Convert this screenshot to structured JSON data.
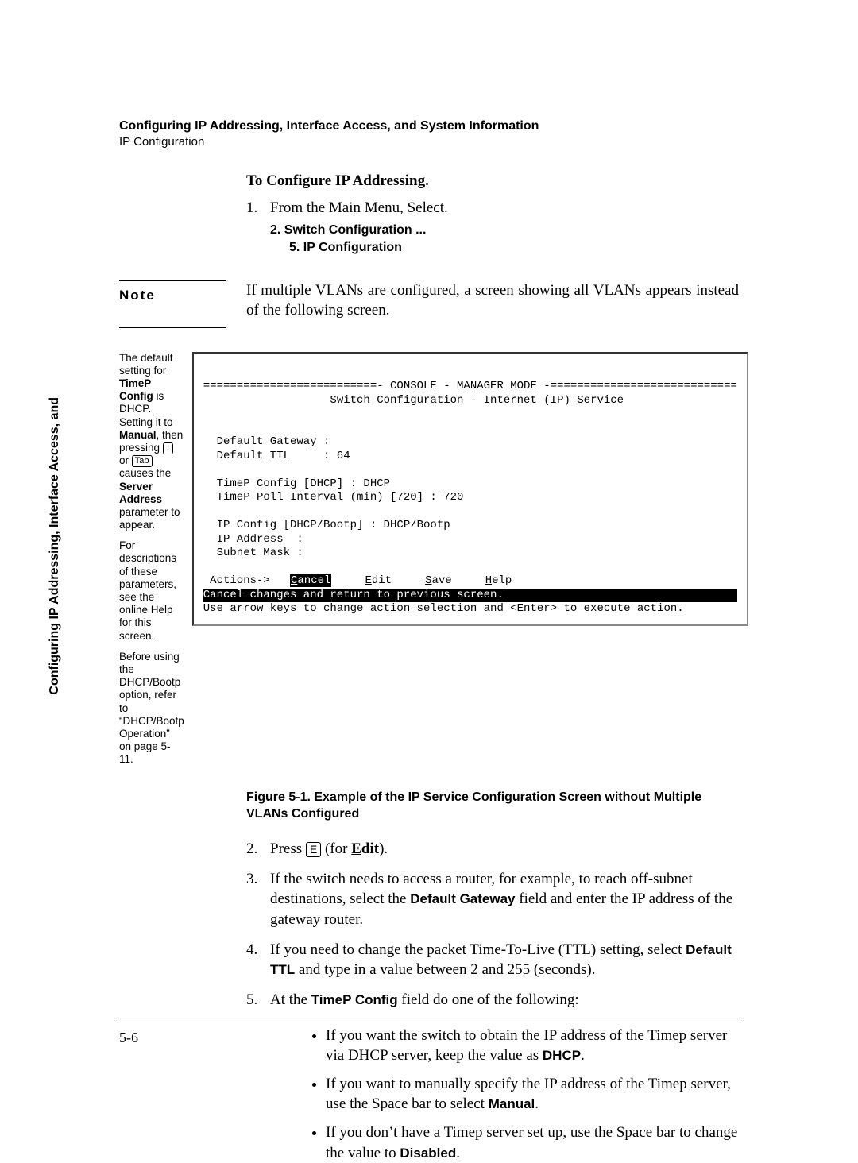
{
  "running_head": "Configuring IP Addressing, Interface Access, and System Information",
  "running_sub": "IP Configuration",
  "side_tab": "Configuring IP Addressing,\nInterface Access, and",
  "heading": "To Configure IP Addressing.",
  "step1": {
    "num": "1.",
    "text": "From the Main Menu, Select."
  },
  "step1_sub1": "2. Switch Configuration ...",
  "step1_sub2": "5. IP Configuration",
  "note_label": "Note",
  "note_text": "If multiple VLANs are configured, a screen showing all VLANs appears instead of the following screen.",
  "annot": {
    "p1_a": "The default setting for ",
    "p1_b": "TimeP Config",
    "p1_c": " is DHCP. Setting it to ",
    "p1_d": "Manual",
    "p1_e": ", then pressing ",
    "p1_key1": "↓",
    "p1_f": " or ",
    "p1_key2": "Tab",
    "p1_g": " causes the ",
    "p1_h": "Server Address",
    "p1_i": " parameter to appear.",
    "p2": "For descriptions of these parameters, see the online Help for this screen.",
    "p3": "Before using the DHCP/Bootp option, refer to “DHCP/Bootp Operation” on page 5-11."
  },
  "console": {
    "header_rule": "==========================- CONSOLE - MANAGER MODE -============================",
    "title": "Switch Configuration - Internet (IP) Service",
    "gateway": "  Default Gateway :",
    "ttl": "  Default TTL     : 64",
    "timep": "  TimeP Config [DHCP] : DHCP",
    "poll": "  TimeP Poll Interval (min) [720] : 720",
    "ipcfg": "  IP Config [DHCP/Bootp] : DHCP/Bootp",
    "ipaddr": "  IP Address  :",
    "subnet": "  Subnet Mask :",
    "actions": " Actions->   ",
    "action_cancel": "Cancel",
    "action_edit": "Edit",
    "action_save": "Save",
    "action_help": "Help",
    "highlight": "Cancel changes and return to previous screen.",
    "hint": "Use arrow keys to change action selection and <Enter> to execute action."
  },
  "figure_caption": "Figure 5-1.  Example of the IP Service Configuration Screen without Multiple VLANs Configured",
  "step2": {
    "num": "2.",
    "pre": "Press ",
    "key": "E",
    "post1": " (for ",
    "edit": "Edit",
    "post2": ")."
  },
  "step3": {
    "num": "3.",
    "pre": "If the switch needs to access a router, for example, to reach off-subnet destinations, select the ",
    "bold": "Default Gateway",
    "post": "  field and enter the IP address of the gateway router."
  },
  "step4": {
    "num": "4.",
    "pre": "If you need to change the packet Time-To-Live (TTL) setting, select ",
    "bold": "Default TTL",
    "post": " and type in a value between 2 and 255 (seconds)."
  },
  "step5": {
    "num": "5.",
    "pre": "At the  ",
    "bold": "TimeP Config",
    "post": "  field do one of the following:"
  },
  "bullet1": {
    "pre": "If you want the switch to obtain the IP address of the Timep server via DHCP server, keep the value as  ",
    "bold": "DHCP",
    "post": "."
  },
  "bullet2": {
    "pre": "If you want to manually specify the IP address of the Timep server, use the Space bar to select  ",
    "bold": "Manual",
    "post": "."
  },
  "bullet3": {
    "pre": "If you don’t have a Timep server set up, use the Space bar to change the value to  ",
    "bold": "Disabled",
    "post": "."
  },
  "page_number": "5-6"
}
